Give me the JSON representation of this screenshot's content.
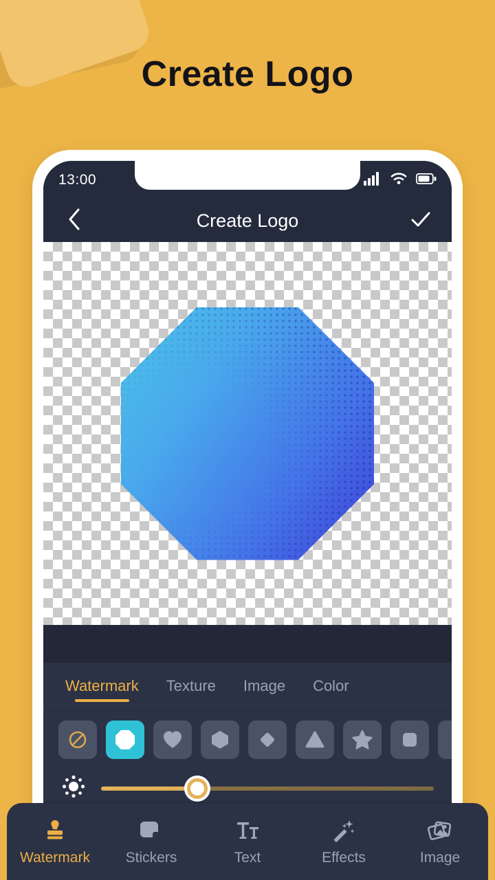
{
  "page": {
    "title": "Create Logo",
    "background_color": "#EDB547",
    "accent_color": "#EDAF46",
    "panel_color": "#2B3245",
    "selected_color": "#2FC2D6"
  },
  "phone": {
    "status_bar": {
      "time": "13:00",
      "icons": [
        "signal-icon",
        "wifi-icon",
        "battery-icon"
      ]
    },
    "app_bar": {
      "back_label": "back-chevron-icon",
      "title": "Create Logo",
      "confirm_label": "check-icon"
    },
    "canvas": {
      "background": "transparent-checkerboard",
      "logo": {
        "shape": "octagon",
        "gradient_from": "#4BC3E8",
        "gradient_to": "#3E3FD8",
        "texture": "halftone-dots"
      }
    },
    "editor": {
      "tabs": [
        {
          "label": "Watermark",
          "active": true
        },
        {
          "label": "Texture",
          "active": false
        },
        {
          "label": "Image",
          "active": false
        },
        {
          "label": "Color",
          "active": false
        }
      ],
      "shapes": [
        {
          "name": "none",
          "icon": "no-shape-icon",
          "selected": false
        },
        {
          "name": "octagon",
          "icon": "octagon-icon",
          "selected": true
        },
        {
          "name": "heart",
          "icon": "heart-icon",
          "selected": false
        },
        {
          "name": "hexagon",
          "icon": "hexagon-icon",
          "selected": false
        },
        {
          "name": "diamond",
          "icon": "diamond-icon",
          "selected": false
        },
        {
          "name": "triangle",
          "icon": "triangle-icon",
          "selected": false
        },
        {
          "name": "star",
          "icon": "star-icon",
          "selected": false
        },
        {
          "name": "rounded-square",
          "icon": "rounded-square-icon",
          "selected": false
        },
        {
          "name": "more",
          "icon": "partial-shape-icon",
          "selected": false
        }
      ],
      "slider": {
        "icon": "brightness-icon",
        "value_percent": 29
      }
    },
    "bottom_nav": [
      {
        "label": "Watermark",
        "icon": "stamp-icon",
        "active": true
      },
      {
        "label": "Stickers",
        "icon": "sticker-icon",
        "active": false
      },
      {
        "label": "Text",
        "icon": "text-icon",
        "active": false
      },
      {
        "label": "Effects",
        "icon": "magic-wand-icon",
        "active": false
      },
      {
        "label": "Image",
        "icon": "photos-icon",
        "active": false
      }
    ]
  }
}
